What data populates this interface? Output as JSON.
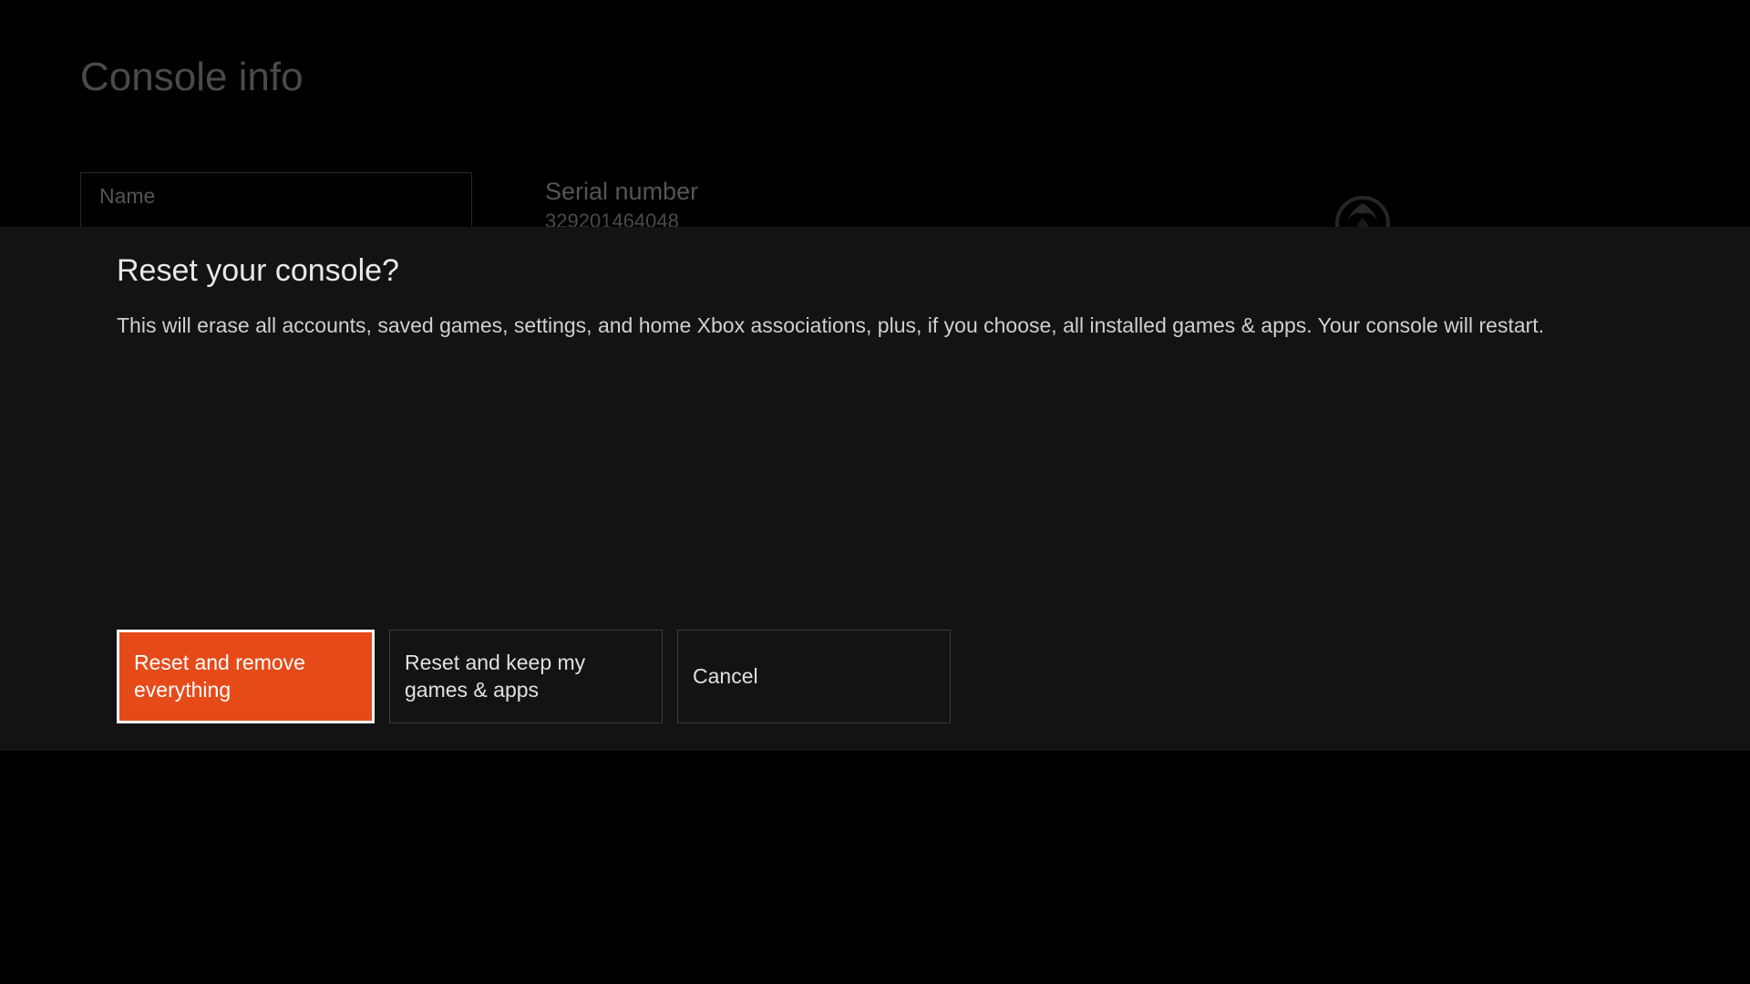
{
  "page": {
    "title": "Console info"
  },
  "console": {
    "name_label": "Name",
    "serial_label": "Serial number",
    "serial_value": "329201464048"
  },
  "dialog": {
    "title": "Reset your console?",
    "description": "This will erase all accounts, saved games, settings, and home Xbox associations, plus, if you choose, all installed games & apps. Your console will restart.",
    "buttons": {
      "reset_remove": "Reset and remove everything",
      "reset_keep": "Reset and keep my games & apps",
      "cancel": "Cancel"
    }
  }
}
